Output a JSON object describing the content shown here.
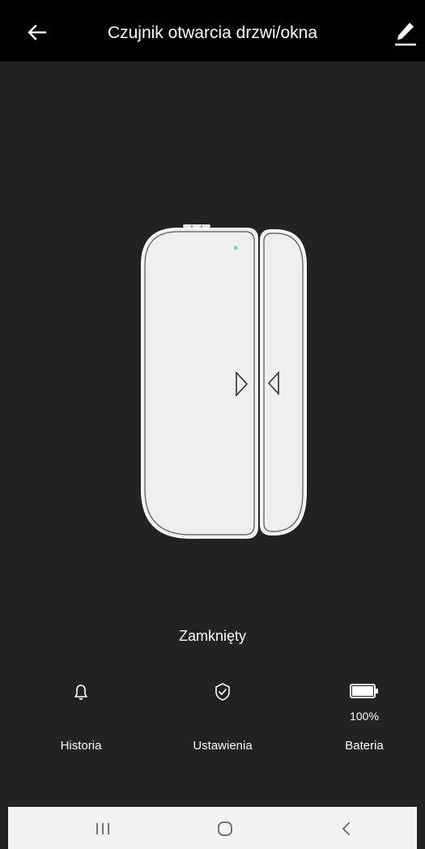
{
  "app_bar": {
    "title": "Czujnik otwarcia drzwi/okna",
    "back_icon": "arrow-left-icon",
    "edit_icon": "pencil-icon"
  },
  "device": {
    "status": "Zamknięty",
    "led_color": "#4fd3c4"
  },
  "features": [
    {
      "label": "Historia",
      "icon": "bell-icon",
      "value": ""
    },
    {
      "label": "Ustawienia",
      "icon": "shield-check-icon",
      "value": ""
    },
    {
      "label": "Bateria",
      "icon": "battery-icon",
      "value": "100%",
      "level": 1.0
    }
  ],
  "system_nav": {
    "recents_icon": "recent-apps-icon",
    "home_icon": "home-icon",
    "back_icon": "chevron-left-icon"
  },
  "colors": {
    "app_bar_bg": "#000000",
    "screen_bg": "#222222",
    "sensor_body": "#eeeeee",
    "nav_bar_bg": "#f2f2f2"
  }
}
